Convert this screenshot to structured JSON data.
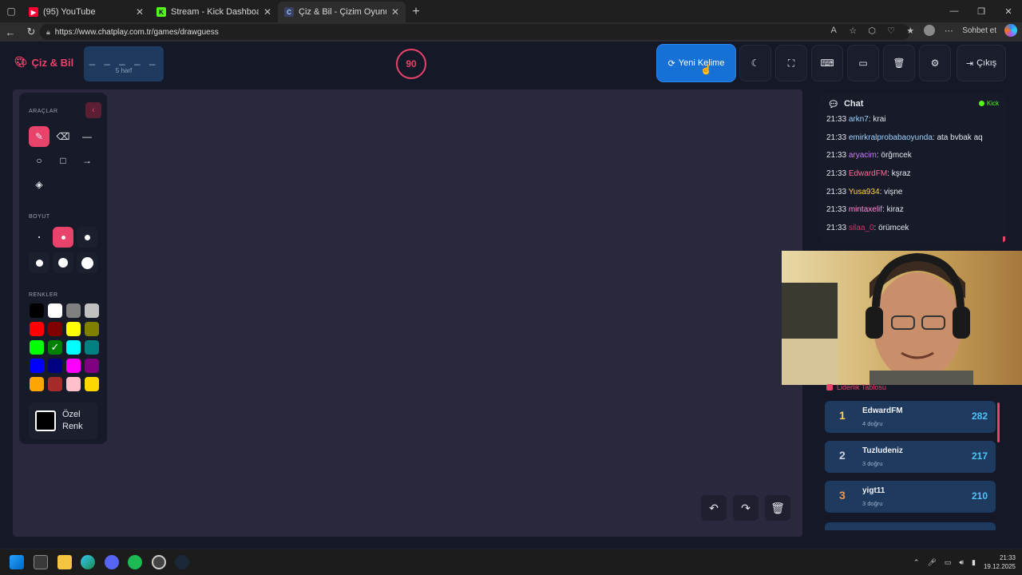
{
  "browser": {
    "tabs": [
      {
        "title": "(95) YouTube",
        "favicon": "youtube-icon",
        "color": "#ff0033"
      },
      {
        "title": "Stream - Kick Dashboard",
        "favicon": "kick-icon",
        "color": "#53fc18"
      },
      {
        "title": "Çiz & Bil - Çizim Oyunu",
        "favicon": "chatplay-icon",
        "color": "#3a3f66"
      }
    ],
    "url": "https://www.chatplay.com.tr/games/drawguess",
    "sohbet_label": "Sohbet et"
  },
  "header": {
    "logo": "Çiz & Bil",
    "word_mask": "_ _ _ _ _",
    "word_length": "5 harf",
    "timer": "90",
    "new_word": "Yeni Kelime",
    "logout": "Çıkış"
  },
  "tools": {
    "section_tools": "ARAÇLAR",
    "section_size": "BOYUT",
    "section_colors": "RENKLER",
    "custom_color_line1": "Özel",
    "custom_color_line2": "Renk",
    "colors": [
      "#000000",
      "#ffffff",
      "#808080",
      "#c0c0c0",
      "#ff0000",
      "#800000",
      "#ffff00",
      "#808000",
      "#00ff00",
      "#008000",
      "#00ffff",
      "#008080",
      "#0000ff",
      "#000080",
      "#ff00ff",
      "#800080",
      "#ffa500",
      "#a52a2a",
      "#ffc0cb",
      "#ffd700"
    ]
  },
  "chat": {
    "title": "Chat",
    "platform": "Kick",
    "messages": [
      {
        "time": "21:33",
        "user": "arkn7",
        "color": "#9fd3ff",
        "text": ": krai"
      },
      {
        "time": "21:33",
        "user": "emirkralprobabaoyunda",
        "color": "#9fd3ff",
        "text": ": ata bvbak aq"
      },
      {
        "time": "21:33",
        "user": "aryacim",
        "color": "#c77dff",
        "text": ": örğmcek"
      },
      {
        "time": "21:33",
        "user": "EdwardFM",
        "color": "#ff6b9a",
        "text": ": kşraz"
      },
      {
        "time": "21:33",
        "user": "Yusa934",
        "color": "#ffd24d",
        "text": ": vişne"
      },
      {
        "time": "21:33",
        "user": "mintaxelif",
        "color": "#ff8fd8",
        "text": ": kiraz"
      },
      {
        "time": "21:33",
        "user": "silaa_0",
        "color": "#d6336c",
        "text": ": örümcek"
      }
    ]
  },
  "leaderboard": {
    "title": "Liderlik Tablosu",
    "entries": [
      {
        "rank": "1",
        "name": "EdwardFM",
        "sub": "4 doğru",
        "score": "282",
        "color": "#ffd24d"
      },
      {
        "rank": "2",
        "name": "Tuzludeniz",
        "sub": "3 doğru",
        "score": "217",
        "color": "#c9d3e0"
      },
      {
        "rank": "3",
        "name": "yigt11",
        "sub": "3 doğru",
        "score": "210",
        "color": "#e69a5a"
      }
    ]
  },
  "taskbar": {
    "time": "21:33",
    "date": "19.12.2025"
  }
}
